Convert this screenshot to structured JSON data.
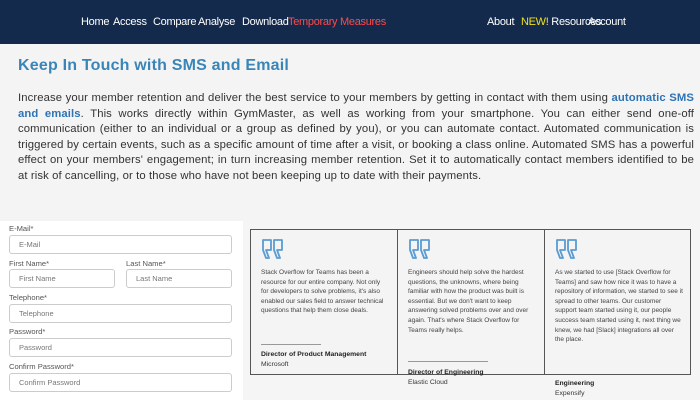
{
  "nav": {
    "home": "Home",
    "access": "Access",
    "compare": "Compare",
    "analyse": "Analyse",
    "download": "Download",
    "temporary": "Temporary Measures",
    "about": "About",
    "new_badge": "NEW!",
    "resources": "Resources",
    "account": "Account",
    "bg_color": "#142a4c",
    "warn_color": "#ff4a4a",
    "new_color": "#f0e020"
  },
  "main": {
    "title": "Keep In Touch with SMS and Email",
    "body_before": "Increase your member retention and deliver the best service to your members by getting in contact with them using ",
    "body_strong": "automatic SMS and emails",
    "body_after": ". This works directly within GymMaster, as well as working from your smartphone. You can either send one-off communication (either to an individual or a group as defined by you), or you can automate contact. Automated communication is triggered by certain events, such as a specific amount of time after a visit, or booking a class online. Automated SMS has a powerful effect on your members' engagement; in turn increasing member retention. Set it to automatically contact members identified to be at risk of cancelling, or to those who have not been keeping up to date with their payments.",
    "title_color": "#3a85b8",
    "strong_color": "#2d73b5"
  },
  "form": {
    "email_label": "E-Mail*",
    "email_placeholder": "E-Mail",
    "first_name_label": "First Name*",
    "first_name_placeholder": "First Name",
    "last_name_label": "Last Name*",
    "last_name_placeholder": "Last Name",
    "telephone_label": "Telephone*",
    "telephone_placeholder": "Telephone",
    "password_label": "Password*",
    "password_placeholder": "Password",
    "confirm_label": "Confirm Password*",
    "confirm_placeholder": "Confirm Password"
  },
  "testimonials": [
    {
      "quote": "Stack Overflow for Teams has been a resource for our entire company. Not only for developers to solve problems, it's also enabled our sales field to answer technical questions that help them close deals.",
      "title": "Director of Product Management",
      "company": "Microsoft"
    },
    {
      "quote": "Engineers should help solve the hardest questions, the unknowns, where being familiar with how the product was built is essential. But we don't want to keep answering solved problems over and over again. That's where Stack Overflow for Teams really helps.",
      "title": "Director of Engineering",
      "company": "Elastic Cloud"
    },
    {
      "quote": "As we started to use [Stack Overflow for Teams] and saw how nice it was to have a repository of information, we started to see it spread to other teams. Our customer support team started using it, our people success team started using it, next thing we knew, we had [Slack] integrations all over the place.",
      "title": "Engineering",
      "company": "Expensify"
    }
  ],
  "icons": {
    "quote_icon": "quote-icon",
    "quote_color": "#5b9bd1"
  }
}
